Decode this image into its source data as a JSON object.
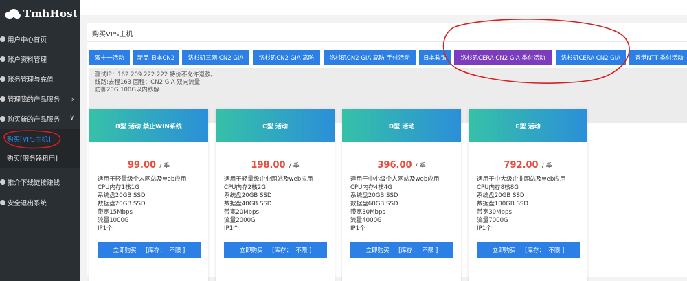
{
  "brand": {
    "name": "TmhHost",
    "logo_icon": "cloud-icon"
  },
  "sidebar": {
    "items": [
      {
        "label": "用户中心首页"
      },
      {
        "label": "账户资料管理"
      },
      {
        "label": "账务管理与充值"
      },
      {
        "label": "管理我的产品服务",
        "chevron": ">"
      },
      {
        "label": "购买新的产品服务",
        "chevron": "v"
      }
    ],
    "sub_items": [
      {
        "label": "购买[VPS主机]",
        "active": true
      },
      {
        "label": "购买[服务器租用]"
      }
    ],
    "bottom_items": [
      {
        "label": "推介下线链接赚钱"
      },
      {
        "label": "安全退出系统"
      }
    ]
  },
  "main": {
    "title": "购买VPS主机",
    "tabs": [
      {
        "label": "双十一活动"
      },
      {
        "label": "新品 日本CN2"
      },
      {
        "label": "洛杉矶三网 CN2 GIA"
      },
      {
        "label": "洛杉矶CN2 GIA 高防"
      },
      {
        "label": "洛杉矶CN2 GIA 高防 手付活动"
      },
      {
        "label": "日本软银"
      },
      {
        "label": "洛杉矶CERA CN2 GIA 季付活动",
        "active": true
      },
      {
        "label": "洛杉矶CERA CN2 GIA"
      },
      {
        "label": "香港NTT 季付活动"
      }
    ],
    "info": {
      "line1": "测试IP：162.209.222.222 特价不允许退款。",
      "line2": "线路:去程163 回程：CN2 GIA 双向流量",
      "line3": "防御20G 100G以内秒解"
    },
    "products": [
      {
        "name": "B型 活动 禁止WIN系统",
        "price": "99.00",
        "unit": "/ 季",
        "specs": [
          "适用于轻量级个人网站及web应用",
          "CPU内存1核1G",
          "系统盘20GB SSD",
          "数据盘20GB SSD",
          "带宽15Mbps",
          "流量1000G",
          "IP1个"
        ],
        "buy_label": "立即购买     [库存：  不限 ]"
      },
      {
        "name": "C型 活动",
        "price": "198.00",
        "unit": "/ 季",
        "specs": [
          "适用于轻量级企业网站及web应用",
          "CPU内存2核2G",
          "系统盘20GB SSD",
          "数据盘40GB SSD",
          "带宽20Mbps",
          "流量2000G",
          "IP1个"
        ],
        "buy_label": "立即购买     [库存：  不限 ]"
      },
      {
        "name": "D型 活动",
        "price": "396.00",
        "unit": "/ 季",
        "specs": [
          "适用于中小级个人网站及web应用",
          "CPU内存4核4G",
          "系统盘20GB SSD",
          "数据盘60GB SSD",
          "带宽30Mbps",
          "流量4000G",
          "IP1个"
        ],
        "buy_label": "立即购买     [库存：  不限 ]"
      },
      {
        "name": "E型 活动",
        "price": "792.00",
        "unit": "/ 季",
        "specs": [
          "适用于中大级企业网站及web应用",
          "CPU内存8核8G",
          "系统盘20GB SSD",
          "数据盘100GB SSD",
          "带宽30Mbps",
          "流量7000G",
          "IP1个"
        ],
        "buy_label": "立即购买     [库存：  不限 ]"
      }
    ]
  },
  "colors": {
    "sidebar_bg": "#2a2f33",
    "accent_blue": "#2b7fe5",
    "active_tab": "#7b3dbd",
    "price_red": "#e74c3c",
    "annotation_red": "#d81e1e"
  }
}
